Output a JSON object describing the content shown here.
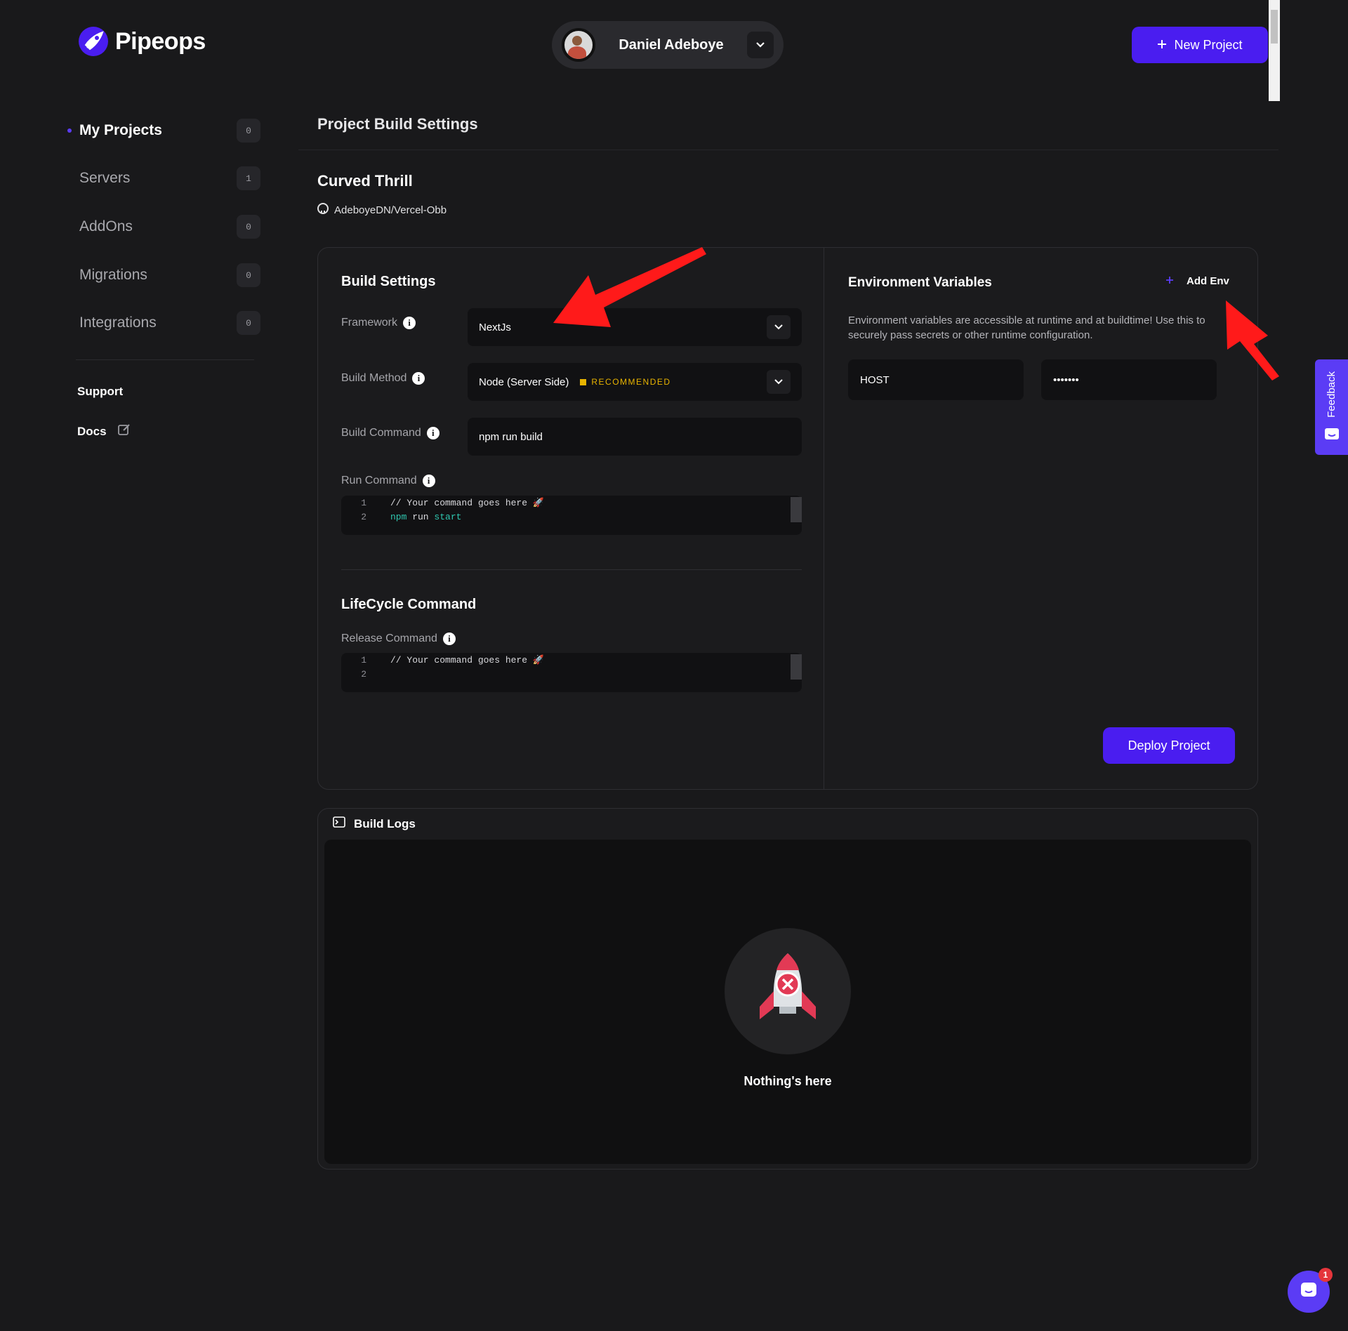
{
  "brand": {
    "name": "Pipeops"
  },
  "user": {
    "name": "Daniel Adeboye"
  },
  "header": {
    "new_project_label": "New Project"
  },
  "sidebar": {
    "items": [
      {
        "label": "My Projects",
        "count": "0",
        "active": true
      },
      {
        "label": "Servers",
        "count": "1"
      },
      {
        "label": "AddOns",
        "count": "0"
      },
      {
        "label": "Migrations",
        "count": "0"
      },
      {
        "label": "Integrations",
        "count": "0"
      }
    ],
    "support_label": "Support",
    "docs_label": "Docs"
  },
  "page": {
    "title": "Project Build Settings",
    "project_name": "Curved Thrill",
    "repo": "AdeboyeDN/Vercel-Obb"
  },
  "build_settings": {
    "title": "Build Settings",
    "framework_label": "Framework",
    "framework_value": "NextJs",
    "build_method_label": "Build Method",
    "build_method_value": "Node (Server Side)",
    "recommended_label": "RECOMMENDED",
    "build_command_label": "Build Command",
    "build_command_value": "npm run build",
    "run_command_label": "Run Command",
    "run_command_lines": [
      {
        "num": "1",
        "comment": "// Your command goes here 🚀"
      },
      {
        "num": "2",
        "cmd": "npm",
        "mid": " run ",
        "arg": "start"
      }
    ]
  },
  "lifecycle": {
    "title": "LifeCycle Command",
    "release_label": "Release Command",
    "release_lines": [
      {
        "num": "1",
        "comment": "// Your command goes here 🚀"
      },
      {
        "num": "2"
      }
    ]
  },
  "env": {
    "title": "Environment Variables",
    "add_label": "Add Env",
    "description": "Environment variables are accessible at runtime and at buildtime! Use this to securely pass secrets or other runtime configuration.",
    "key": "HOST",
    "value": "•••••••"
  },
  "deploy_label": "Deploy Project",
  "logs": {
    "title": "Build Logs",
    "empty_text": "Nothing's here"
  },
  "feedback_label": "Feedback",
  "chat_badge": "1",
  "colors": {
    "accent": "#4a1df0",
    "warning": "#e8b400",
    "annotation": "#ff1a1a"
  }
}
